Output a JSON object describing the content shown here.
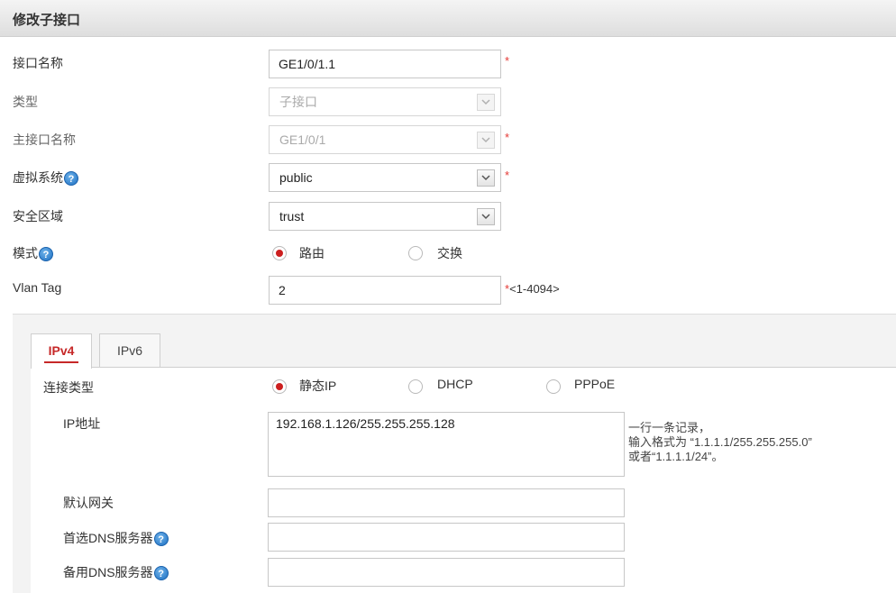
{
  "header": {
    "title": "修改子接口"
  },
  "form": {
    "interface_name": {
      "label": "接口名称",
      "value": "GE1/0/1.1",
      "required": "*"
    },
    "type": {
      "label": "类型",
      "value": "子接口"
    },
    "parent_interface": {
      "label": "主接口名称",
      "value": "GE1/0/1",
      "required": "*"
    },
    "virtual_system": {
      "label": "虚拟系统",
      "value": "public",
      "required": "*"
    },
    "security_zone": {
      "label": "安全区域",
      "value": "trust"
    },
    "mode": {
      "label": "模式",
      "options": [
        "路由",
        "交换"
      ],
      "selected": "路由"
    },
    "vlan_tag": {
      "label": "Vlan Tag",
      "value": "2",
      "required": "*",
      "range": "<1-4094>"
    }
  },
  "tabs": [
    {
      "label": "IPv4",
      "active": true
    },
    {
      "label": "IPv6",
      "active": false
    }
  ],
  "ipv4": {
    "connection_type": {
      "label": "连接类型",
      "options": [
        "静态IP",
        "DHCP",
        "PPPoE"
      ],
      "selected": "静态IP"
    },
    "ip_address": {
      "label": "IP地址",
      "value": "192.168.1.126/255.255.255.128",
      "hint_lines": [
        "一行一条记录，",
        "输入格式为 “1.1.1.1/255.255.255.0”",
        "或者“1.1.1.1/24”。"
      ]
    },
    "default_gateway": {
      "label": "默认网关",
      "value": ""
    },
    "primary_dns": {
      "label": "首选DNS服务器",
      "value": ""
    },
    "secondary_dns": {
      "label": "备用DNS服务器",
      "value": ""
    }
  },
  "icons": {
    "help": "?"
  },
  "colors": {
    "accent": "#c62828",
    "help_icon": "#1d6fc2",
    "required": "#e53935"
  }
}
